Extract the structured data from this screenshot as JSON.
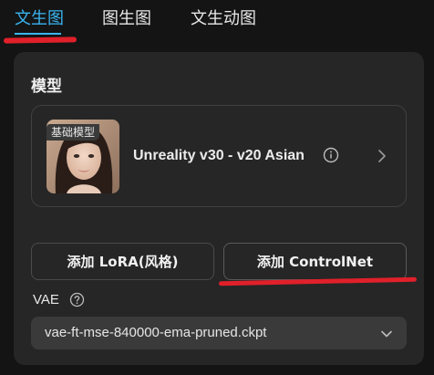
{
  "tabs": [
    {
      "label": "文生图",
      "active": true
    },
    {
      "label": "图生图",
      "active": false
    },
    {
      "label": "文生动图",
      "active": false
    }
  ],
  "colors": {
    "accent": "#39b4f0",
    "annotation": "#e0202a",
    "panel": "#262626",
    "background": "#141414"
  },
  "model": {
    "section_title": "模型",
    "badge": "基础模型",
    "name": "Unreality v30 - v20 Asian"
  },
  "buttons": {
    "lora": "添加 LoRA(风格)",
    "controlnet": "添加 ControlNet"
  },
  "vae": {
    "label": "VAE",
    "value": "vae-ft-mse-840000-ema-pruned.ckpt"
  },
  "icons": [
    "info-icon",
    "chevron-right-icon",
    "help-icon",
    "chevron-down-icon"
  ]
}
